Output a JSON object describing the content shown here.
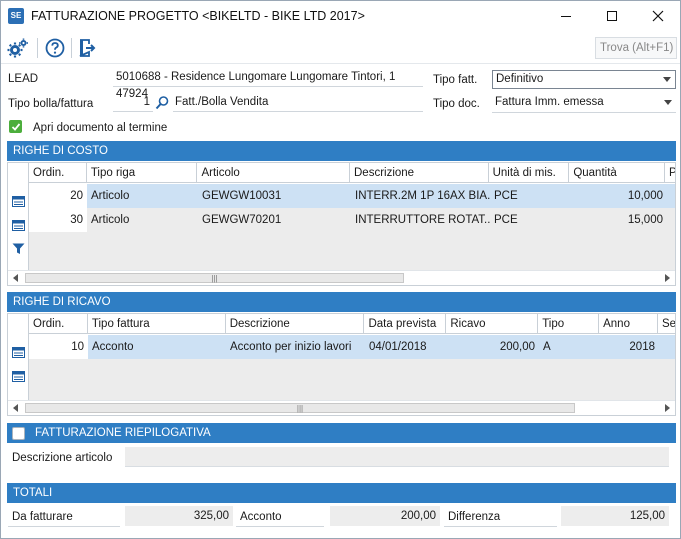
{
  "window": {
    "title": "FATTURAZIONE PROGETTO <BIKELTD - BIKE LTD 2017>",
    "app_icon_text": "SE"
  },
  "toolbar": {
    "search_placeholder": "Trova (Alt+F1)"
  },
  "header": {
    "lead_label": "LEAD",
    "lead_value": "5010688 - Residence Lungomare  Lungomare Tintori, 1 47924",
    "tipo_fatt_label": "Tipo fatt.",
    "tipo_fatt_value": "Definitivo",
    "tipo_bolla_label": "Tipo bolla/fattura",
    "tipo_bolla_code": "1",
    "tipo_bolla_desc": "Fatt./Bolla Vendita",
    "tipo_doc_label": "Tipo doc.",
    "tipo_doc_value": "Fattura Imm. emessa",
    "apri_doc_label": "Apri documento al termine"
  },
  "righe_costo": {
    "title": "RIGHE DI COSTO",
    "columns": [
      "Ordin.",
      "Tipo riga",
      "Articolo",
      "Descrizione",
      "Unità di mis.",
      "Quantità",
      "P"
    ],
    "rows": [
      {
        "ordin": "20",
        "tipo": "Articolo",
        "articolo": "GEWGW10031",
        "descrizione": "INTERR.2M 1P 16AX BIA...",
        "um": "PCE",
        "quantita": "10,000"
      },
      {
        "ordin": "30",
        "tipo": "Articolo",
        "articolo": "GEWGW70201",
        "descrizione": "INTERRUTTORE ROTAT....",
        "um": "PCE",
        "quantita": "15,000"
      }
    ]
  },
  "righe_ricavo": {
    "title": "RIGHE DI RICAVO",
    "columns": [
      "Ordin.",
      "Tipo fattura",
      "Descrizione",
      "Data prevista",
      "Ricavo",
      "Tipo",
      "Anno",
      "Se"
    ],
    "rows": [
      {
        "ordin": "10",
        "tipo_fattura": "Acconto",
        "descrizione": "Acconto per inizio lavori",
        "data": "04/01/2018",
        "ricavo": "200,00",
        "tipo": "A",
        "anno": "2018"
      }
    ]
  },
  "riepilogativa": {
    "title": "FATTURAZIONE RIEPILOGATIVA",
    "desc_label": "Descrizione articolo"
  },
  "totali": {
    "title": "TOTALI",
    "da_fatturare_label": "Da fatturare",
    "da_fatturare_value": "325,00",
    "acconto_label": "Acconto",
    "acconto_value": "200,00",
    "differenza_label": "Differenza",
    "differenza_value": "125,00"
  },
  "colors": {
    "section_header": "#2f7ec4",
    "selected_row": "#cde1f4",
    "check_green": "#4cae3c"
  }
}
